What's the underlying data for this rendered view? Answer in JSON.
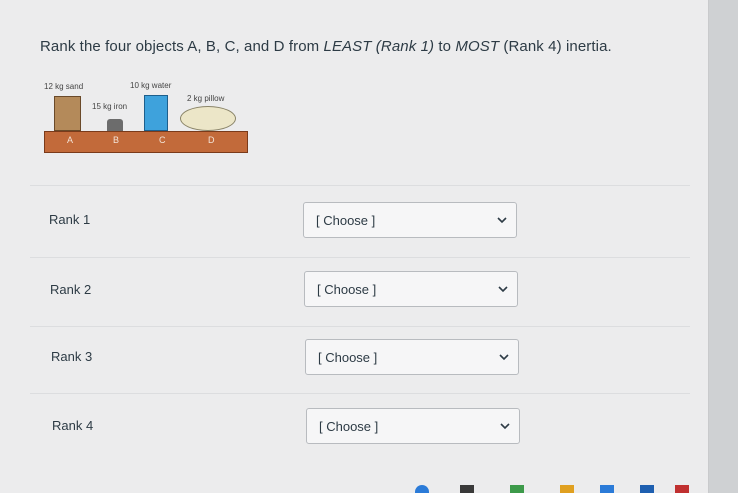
{
  "question": {
    "prefix": "Rank the four objects A, B, C, and D from ",
    "least": "LEAST",
    "rank1_paren": " (Rank 1)",
    "to": " to ",
    "most": "MOST",
    "rank4_paren": " (Rank 4)",
    "suffix": " inertia."
  },
  "diagram": {
    "labels": {
      "sand": "12 kg sand",
      "water": "10 kg water",
      "iron": "15 kg iron",
      "pillow": "2 kg pillow"
    },
    "base_letters": [
      "A",
      "B",
      "C",
      "D"
    ]
  },
  "ranks": [
    {
      "label": "Rank 1",
      "selected": "[ Choose ]"
    },
    {
      "label": "Rank 2",
      "selected": "[ Choose ]"
    },
    {
      "label": "Rank 3",
      "selected": "[ Choose ]"
    },
    {
      "label": "Rank 4",
      "selected": "[ Choose ]"
    }
  ],
  "colors": {
    "text": "#2d3b45",
    "base": "#c26a3a",
    "water": "#3ea2dc",
    "sand": "#b48a5a",
    "pillow": "#ece6c8"
  }
}
